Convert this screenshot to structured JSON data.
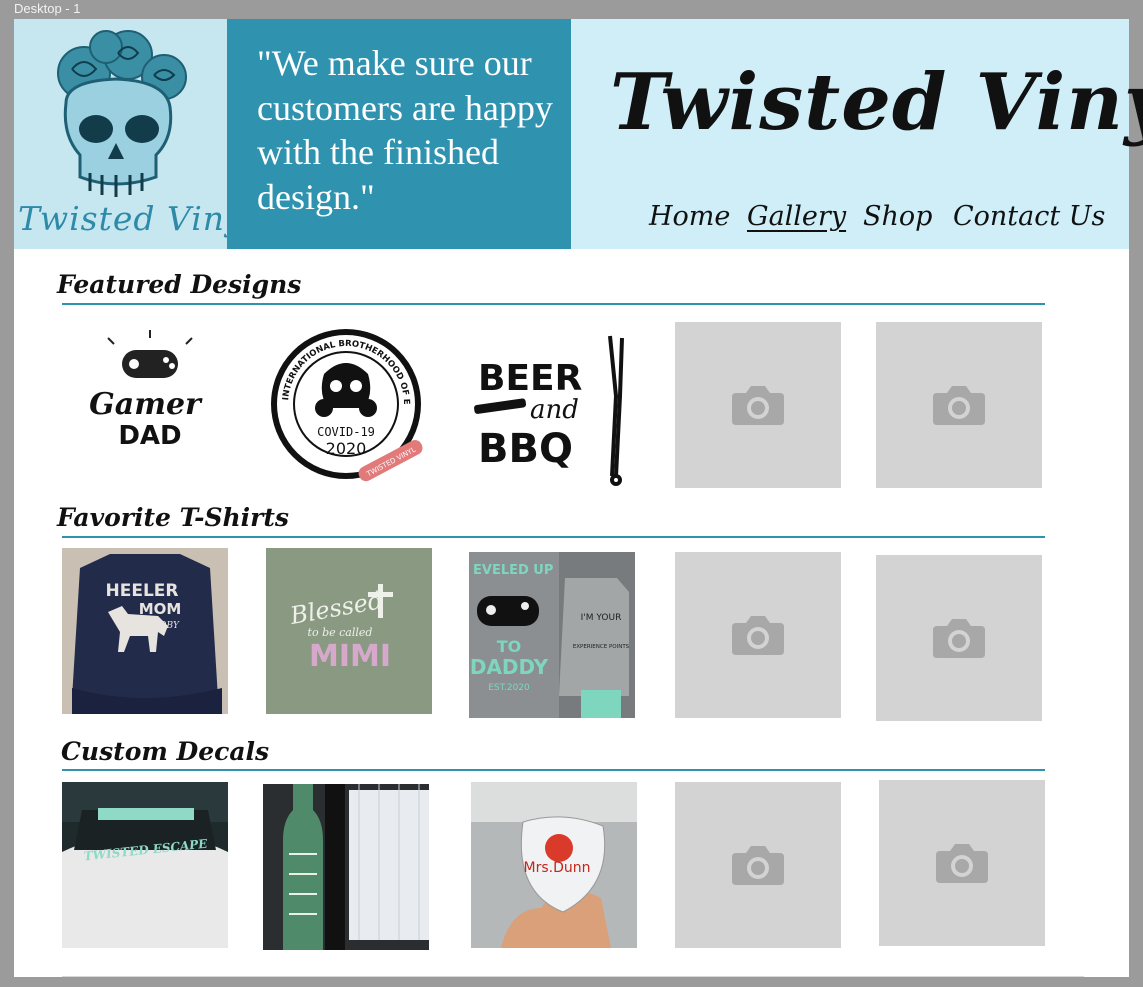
{
  "canvas": {
    "label": "Desktop - 1"
  },
  "header": {
    "logo_text": "Twisted Vinyl",
    "quote": "\"We make sure our customers are happy with the finished design.\"",
    "brand": "Twisted Vinyl",
    "nav": [
      {
        "label": "Home",
        "active": false
      },
      {
        "label": "Gallery",
        "active": true
      },
      {
        "label": "Shop",
        "active": false
      },
      {
        "label": "Contact Us",
        "active": false
      }
    ]
  },
  "sections": [
    {
      "title": "Featured Designs",
      "tiles": [
        {
          "kind": "design",
          "name": "gamer-dad",
          "text": [
            "Gamer",
            "DAD"
          ]
        },
        {
          "kind": "design",
          "name": "covid-badge",
          "text": [
            "INTERNATIONAL BROTHERHOOD OF ESSENTIAL WORKERS",
            "COVID-19",
            "2020",
            "TWISTED VINYL"
          ]
        },
        {
          "kind": "design",
          "name": "beer-bbq",
          "text": [
            "BEER",
            "and",
            "BBQ"
          ]
        },
        {
          "kind": "placeholder"
        },
        {
          "kind": "placeholder"
        }
      ]
    },
    {
      "title": "Favorite T-Shirts",
      "tiles": [
        {
          "kind": "photo",
          "name": "heeler-mom-shirt",
          "text": [
            "HEELER",
            "MOM",
            "TOBY"
          ]
        },
        {
          "kind": "photo",
          "name": "blessed-mimi-shirt",
          "text": [
            "Blessed",
            "to be called",
            "MIMI"
          ]
        },
        {
          "kind": "photo",
          "name": "leveled-up-daddy-shirt",
          "text": [
            "EVELED UP",
            "TO",
            "DADDY",
            "EST.2020",
            "I'M YOUR",
            "EXPERIENCE POINTS"
          ]
        },
        {
          "kind": "placeholder"
        },
        {
          "kind": "placeholder"
        }
      ]
    },
    {
      "title": "Custom Decals",
      "tiles": [
        {
          "kind": "photo",
          "name": "windshield-decal",
          "text": [
            "TWISTED ESCAPE"
          ]
        },
        {
          "kind": "photo",
          "name": "wine-bottle-decal",
          "text": []
        },
        {
          "kind": "photo",
          "name": "wine-glass-decal",
          "text": [
            "Mrs.Dunn"
          ]
        },
        {
          "kind": "placeholder"
        },
        {
          "kind": "placeholder"
        }
      ]
    }
  ],
  "colors": {
    "accent": "#2f93b0",
    "header_bg": "#cfeef8",
    "placeholder": "#d3d3d3",
    "placeholder_icon": "#a8a8a8"
  },
  "icons": {
    "placeholder": "camera-icon"
  }
}
